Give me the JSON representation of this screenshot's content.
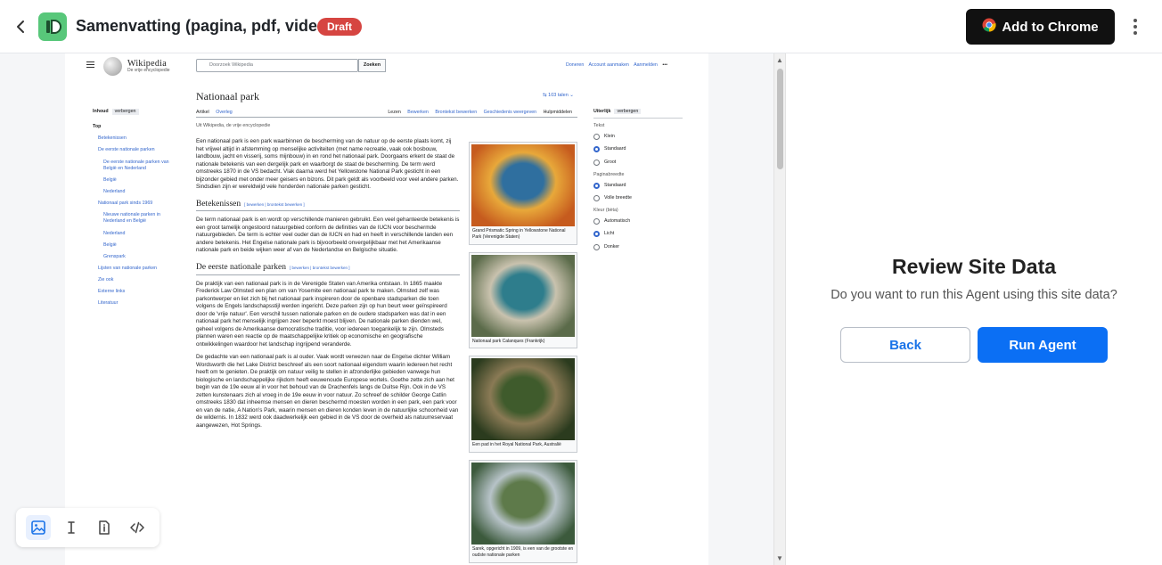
{
  "header": {
    "title": "Samenvatting (pagina, pdf, video)",
    "badge": "Draft",
    "cta": "Add to Chrome"
  },
  "review": {
    "title": "Review Site Data",
    "subtitle": "Do you want to run this Agent using this site data?",
    "back": "Back",
    "run": "Run Agent"
  },
  "wiki": {
    "brand": "Wikipedia",
    "tagline": "De vrije encyclopedie",
    "search_placeholder": "Doorzoek Wikipedia",
    "search_button": "Zoeken",
    "top_links": [
      "Doneren",
      "Account aanmaken",
      "Aanmelden",
      "•••"
    ],
    "title": "Nationaal park",
    "languages": "103 talen",
    "tabs_left": [
      "Artikel",
      "Overleg"
    ],
    "tabs_right": [
      "Lezen",
      "Bewerken",
      "Brontekst bewerken",
      "Geschiedenis weergeven",
      "Hulpmiddelen"
    ],
    "from": "Uit Wikipedia, de vrije encyclopedie",
    "toc": {
      "heading": "Inhoud",
      "hide": "verbergen",
      "items": [
        {
          "label": "Top",
          "level": "top"
        },
        {
          "label": "Betekenissen",
          "level": "i1"
        },
        {
          "label": "De eerste nationale parken",
          "level": "i1"
        },
        {
          "label": "De eerste nationale parken van België en Nederland",
          "level": "i2"
        },
        {
          "label": "België",
          "level": "i3"
        },
        {
          "label": "Nederland",
          "level": "i3"
        },
        {
          "label": "Nationaal park sinds 1969",
          "level": "i1"
        },
        {
          "label": "Nieuwe nationale parken in Nederland en België",
          "level": "i2"
        },
        {
          "label": "Nederland",
          "level": "i3"
        },
        {
          "label": "België",
          "level": "i3"
        },
        {
          "label": "Grenspark",
          "level": "i3"
        },
        {
          "label": "Lijsten van nationale parken",
          "level": "i1"
        },
        {
          "label": "Zie ook",
          "level": "i1"
        },
        {
          "label": "Externe links",
          "level": "i1"
        },
        {
          "label": "Literatuur",
          "level": "i1"
        }
      ]
    },
    "intro": "Een nationaal park is een park waarbinnen de bescherming van de natuur op de eerste plaats komt, zij het vrijwel altijd in afstemming op menselijke activiteiten (met name recreatie, vaak ook bosbouw, landbouw, jacht en visserij, soms mijnbouw) in en rond het nationaal park. Doorgaans erkent de staat de nationale betekenis van een dergelijk park en waarborgt de staat de bescherming. De term werd omstreeks 1870 in de VS bedacht. Vlak daarna werd het Yellowstone National Park gesticht in een bijzonder gebied met onder meer geisers en bizons. Dit park geldt als voorbeeld voor veel andere parken. Sindsdien zijn er wereldwijd vele honderden nationale parken gesticht.",
    "sections": [
      {
        "heading": "Betekenissen",
        "edit": "[ bewerken | brontekst bewerken ]",
        "paras": [
          "De term nationaal park is en wordt op verschillende manieren gebruikt. Een veel gehanteerde betekenis is een groot tamelijk ongestoord natuurgebied conform de definities van de IUCN voor beschermde natuurgebieden. De term is echter veel ouder dan de IUCN en had en heeft in verschillende landen een andere betekenis. Het Engelse nationale park is bijvoorbeeld onvergelijkbaar met het Amerikaanse nationale park en beide wijken weer af van de Nederlandse en Belgische situatie."
        ]
      },
      {
        "heading": "De eerste nationale parken",
        "edit": "[ bewerken | brontekst bewerken ]",
        "paras": [
          "De praktijk van een nationaal park is in de Verenigde Staten van Amerika ontstaan. In 1865 maakte Frederick Law Olmsted een plan om van Yosemite een nationaal park te maken. Olmsted zelf was parkontwerper en liet zich bij het nationaal park inspireren door de openbare stadsparken die toen volgens de Engels landschapsstijl werden ingericht. Deze parken zijn op hun beurt weer geïnspireerd door de 'vrije natuur'. Een verschil tussen nationale parken en de oudere stadsparken was dat in een nationaal park het menselijk ingrijpen zeer beperkt moest blijven. De nationale parken dienden wel, geheel volgens de Amerikaanse democratische traditie, voor iedereen toegankelijk te zijn. Olmsteds plannen waren een reactie op de maatschappelijke kritiek op economische en geografische ontwikkelingen waardoor het landschap ingrijpend veranderde.",
          "De gedachte van een nationaal park is al ouder. Vaak wordt verwezen naar de Engelse dichter William Wordsworth die het Lake District beschreef als een soort nationaal eigendom waarin iedereen het recht heeft om te genieten. De praktijk om natuur veilig te stellen in afzonderlijke gebieden vanwege hun biologische en landschappelijke rijkdom heeft eeuwenoude Europese wortels. Goethe zette zich aan het begin van de 19e eeuw al in voor het behoud van de Drachenfels langs de Duitse Rijn. Ook in de VS zetten kunstenaars zich al vroeg in de 19e eeuw in voor natuur. Zo schreef de schilder George Catlin omstreeks 1830 dat inheemse mensen en dieren beschermd moesten worden in een park, een park voor en van de natie, A Nation's Park, waarin mensen en dieren konden leven in de natuurlijke schoonheid van de wildernis. In 1832 werd ook daadwerkelijk een gebied in de VS door de overheid als natuurreservaat aangewezen, Hot Springs."
        ]
      }
    ],
    "figures": [
      {
        "caption": "Grand Prismatic Spring in Yellowstone National Park (Verenigde Staten)",
        "colors": [
          "#2f6f9f",
          "#e8a83a",
          "#c65b1e"
        ]
      },
      {
        "caption": "Nationaal park Calanques (Frankrijk)",
        "colors": [
          "#2e7d8c",
          "#c9c2ae",
          "#5b6b4a"
        ]
      },
      {
        "caption": "Een pad in het Royal National Park, Australië",
        "colors": [
          "#3f5b2c",
          "#8a7a55",
          "#2b3b1e"
        ]
      },
      {
        "caption": "Sarek, opgericht in 1909, is een van de grootste en oudste nationale parken",
        "colors": [
          "#5e7a4a",
          "#b7c3c8",
          "#3c5a3c"
        ]
      }
    ],
    "appearance": {
      "heading": "Uiterlijk",
      "hide": "verbergen",
      "groups": [
        {
          "label": "Tekst",
          "options": [
            {
              "label": "Klein",
              "on": false
            },
            {
              "label": "Standaard",
              "on": true
            },
            {
              "label": "Groot",
              "on": false
            }
          ]
        },
        {
          "label": "Paginabreedte",
          "options": [
            {
              "label": "Standaard",
              "on": true
            },
            {
              "label": "Volle breedte",
              "on": false
            }
          ]
        },
        {
          "label": "Kleur (bèta)",
          "options": [
            {
              "label": "Automatisch",
              "on": false
            },
            {
              "label": "Licht",
              "on": true
            },
            {
              "label": "Donker",
              "on": false
            }
          ]
        }
      ]
    }
  },
  "tools": [
    {
      "name": "image-tool-icon",
      "active": true
    },
    {
      "name": "text-cursor-tool-icon",
      "active": false
    },
    {
      "name": "document-tool-icon",
      "active": false
    },
    {
      "name": "code-tool-icon",
      "active": false
    }
  ],
  "colors": {
    "accent": "#0b6ff4",
    "badge": "#d64541",
    "logo": "#58c77a",
    "link": "#3366cc"
  }
}
